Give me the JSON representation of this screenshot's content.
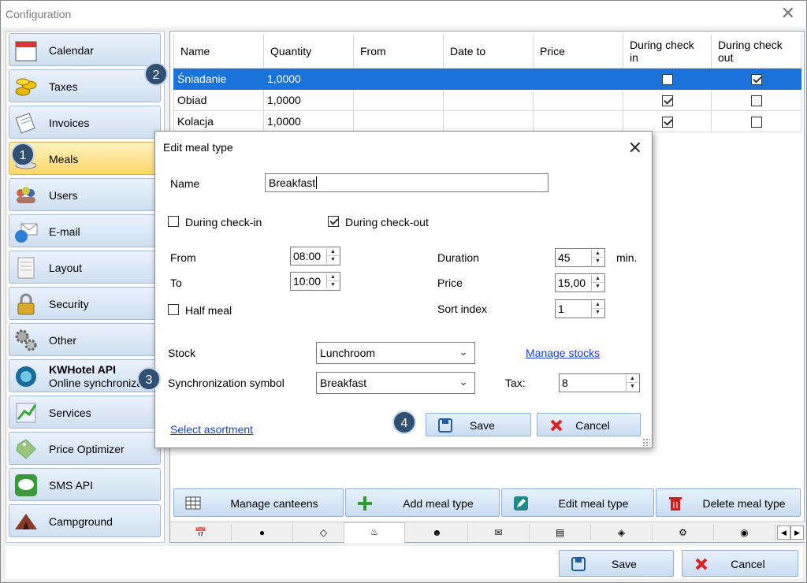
{
  "window": {
    "title": "Configuration"
  },
  "sidebar": {
    "items": [
      {
        "label": "Calendar",
        "icon": "calendar-icon"
      },
      {
        "label": "Taxes",
        "icon": "coins-icon"
      },
      {
        "label": "Invoices",
        "icon": "invoice-icon"
      },
      {
        "label": "Meals",
        "icon": "meal-icon"
      },
      {
        "label": "Users",
        "icon": "users-icon"
      },
      {
        "label": "E-mail",
        "icon": "email-icon"
      },
      {
        "label": "Layout",
        "icon": "layout-icon"
      },
      {
        "label": "Security",
        "icon": "lock-icon"
      },
      {
        "label": "Other",
        "icon": "gears-icon"
      },
      {
        "label": "KWHotel API",
        "label2": "Online synchronization",
        "icon": "sync-icon"
      },
      {
        "label": "Services",
        "icon": "services-icon"
      },
      {
        "label": "Price Optimizer",
        "icon": "price-tag-icon"
      },
      {
        "label": "SMS API",
        "icon": "sms-icon"
      },
      {
        "label": "Campground",
        "icon": "tent-icon"
      }
    ]
  },
  "grid": {
    "headers": [
      "Name",
      "Quantity",
      "From",
      "Date to",
      "Price",
      "During check in",
      "During check out"
    ],
    "rows": [
      {
        "name": "Śniadanie",
        "quantity": "1,0000",
        "from": "",
        "date_to": "",
        "price": "",
        "checkin": false,
        "checkout": true
      },
      {
        "name": "Obiad",
        "quantity": "1,0000",
        "from": "",
        "date_to": "",
        "price": "",
        "checkin": true,
        "checkout": false
      },
      {
        "name": "Kolacja",
        "quantity": "1,0000",
        "from": "",
        "date_to": "",
        "price": "",
        "checkin": true,
        "checkout": false
      }
    ]
  },
  "actions": {
    "manage_canteens": "Manage canteens",
    "add_meal_type": "Add meal type",
    "edit_meal_type": "Edit meal type",
    "delete_meal_type": "Delete meal type"
  },
  "footer": {
    "save": "Save",
    "cancel": "Cancel"
  },
  "dialog": {
    "title": "Edit meal type",
    "name_label": "Name",
    "name_value": "Breakfast",
    "checkin_label": "During check-in",
    "checkout_label": "During check-out",
    "from_label": "From",
    "from_value": "08:00",
    "to_label": "To",
    "to_value": "10:00",
    "half_meal_label": "Half meal",
    "duration_label": "Duration",
    "duration_value": "45",
    "duration_unit": "min.",
    "price_label": "Price",
    "price_value": "15,00",
    "sort_label": "Sort index",
    "sort_value": "1",
    "stock_label": "Stock",
    "stock_value": "Lunchroom",
    "manage_stocks": "Manage stocks",
    "sync_label": "Synchronization symbol",
    "sync_value": "Breakfast",
    "tax_label": "Tax:",
    "tax_value": "8",
    "select_asortment": "Select asortment",
    "save": "Save",
    "cancel": "Cancel"
  },
  "markers": [
    "1",
    "2",
    "3",
    "4"
  ],
  "colors": {
    "selection": "#1a73d9",
    "marker": "#2f4f73",
    "button": "#c9dcf2"
  }
}
